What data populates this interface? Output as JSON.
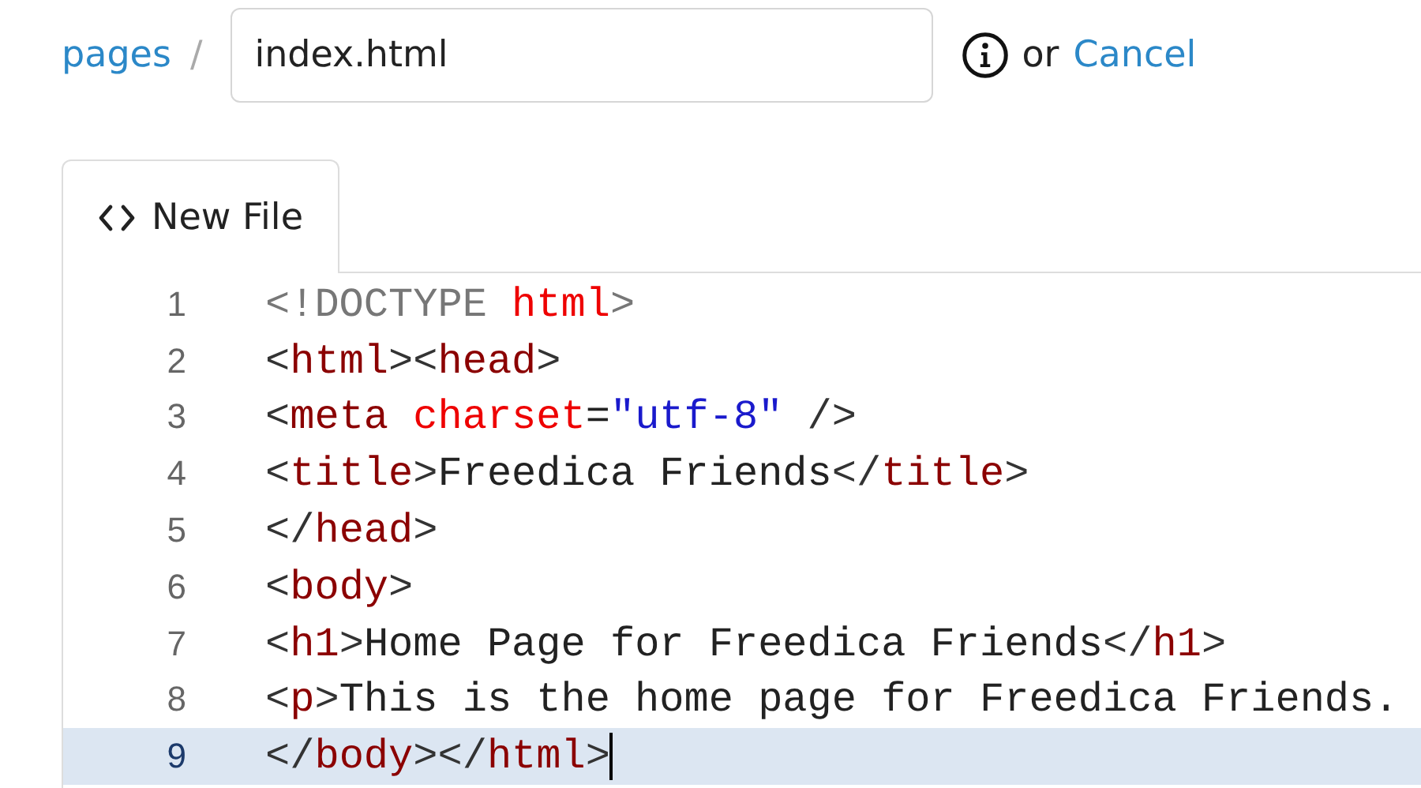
{
  "breadcrumb": {
    "link": "pages",
    "separator": "/"
  },
  "filename_field": {
    "value": "index.html"
  },
  "actions": {
    "or": "or",
    "cancel": "Cancel"
  },
  "tab": {
    "label": "New File",
    "selected": true
  },
  "editor": {
    "lines": [
      {
        "number": "1",
        "selected": false,
        "tokens": [
          {
            "kind": "doctype",
            "text": "<!DOCTYPE "
          },
          {
            "kind": "attr",
            "text": "html"
          },
          {
            "kind": "doctype",
            "text": ">"
          }
        ]
      },
      {
        "number": "2",
        "selected": false,
        "tokens": [
          {
            "kind": "bracket",
            "text": "<"
          },
          {
            "kind": "tag",
            "text": "html"
          },
          {
            "kind": "bracket",
            "text": "><"
          },
          {
            "kind": "tag",
            "text": "head"
          },
          {
            "kind": "bracket",
            "text": ">"
          }
        ]
      },
      {
        "number": "3",
        "selected": false,
        "tokens": [
          {
            "kind": "bracket",
            "text": "<"
          },
          {
            "kind": "tag",
            "text": "meta"
          },
          {
            "kind": "attr",
            "text": " charset"
          },
          {
            "kind": "text",
            "text": "="
          },
          {
            "kind": "string",
            "text": "\"utf-8\""
          },
          {
            "kind": "bracket",
            "text": " />"
          }
        ]
      },
      {
        "number": "4",
        "selected": false,
        "tokens": [
          {
            "kind": "bracket",
            "text": "<"
          },
          {
            "kind": "tag",
            "text": "title"
          },
          {
            "kind": "bracket",
            "text": ">"
          },
          {
            "kind": "text",
            "text": "Freedica Friends"
          },
          {
            "kind": "bracket",
            "text": "</"
          },
          {
            "kind": "tag",
            "text": "title"
          },
          {
            "kind": "bracket",
            "text": ">"
          }
        ]
      },
      {
        "number": "5",
        "selected": false,
        "tokens": [
          {
            "kind": "bracket",
            "text": "</"
          },
          {
            "kind": "tag",
            "text": "head"
          },
          {
            "kind": "bracket",
            "text": ">"
          }
        ]
      },
      {
        "number": "6",
        "selected": false,
        "tokens": [
          {
            "kind": "bracket",
            "text": "<"
          },
          {
            "kind": "tag",
            "text": "body"
          },
          {
            "kind": "bracket",
            "text": ">"
          }
        ]
      },
      {
        "number": "7",
        "selected": false,
        "tokens": [
          {
            "kind": "bracket",
            "text": "<"
          },
          {
            "kind": "tag",
            "text": "h1"
          },
          {
            "kind": "bracket",
            "text": ">"
          },
          {
            "kind": "text",
            "text": "Home Page for Freedica Friends"
          },
          {
            "kind": "bracket",
            "text": "</"
          },
          {
            "kind": "tag",
            "text": "h1"
          },
          {
            "kind": "bracket",
            "text": ">"
          }
        ]
      },
      {
        "number": "8",
        "selected": false,
        "tokens": [
          {
            "kind": "bracket",
            "text": "<"
          },
          {
            "kind": "tag",
            "text": "p"
          },
          {
            "kind": "bracket",
            "text": ">"
          },
          {
            "kind": "text",
            "text": "This is the home page for Freedica Friends."
          }
        ]
      },
      {
        "number": "9",
        "selected": true,
        "tokens": [
          {
            "kind": "bracket",
            "text": "</"
          },
          {
            "kind": "tag",
            "text": "body"
          },
          {
            "kind": "bracket",
            "text": "></"
          },
          {
            "kind": "tag",
            "text": "html"
          },
          {
            "kind": "bracket",
            "text": ">"
          }
        ]
      }
    ]
  }
}
